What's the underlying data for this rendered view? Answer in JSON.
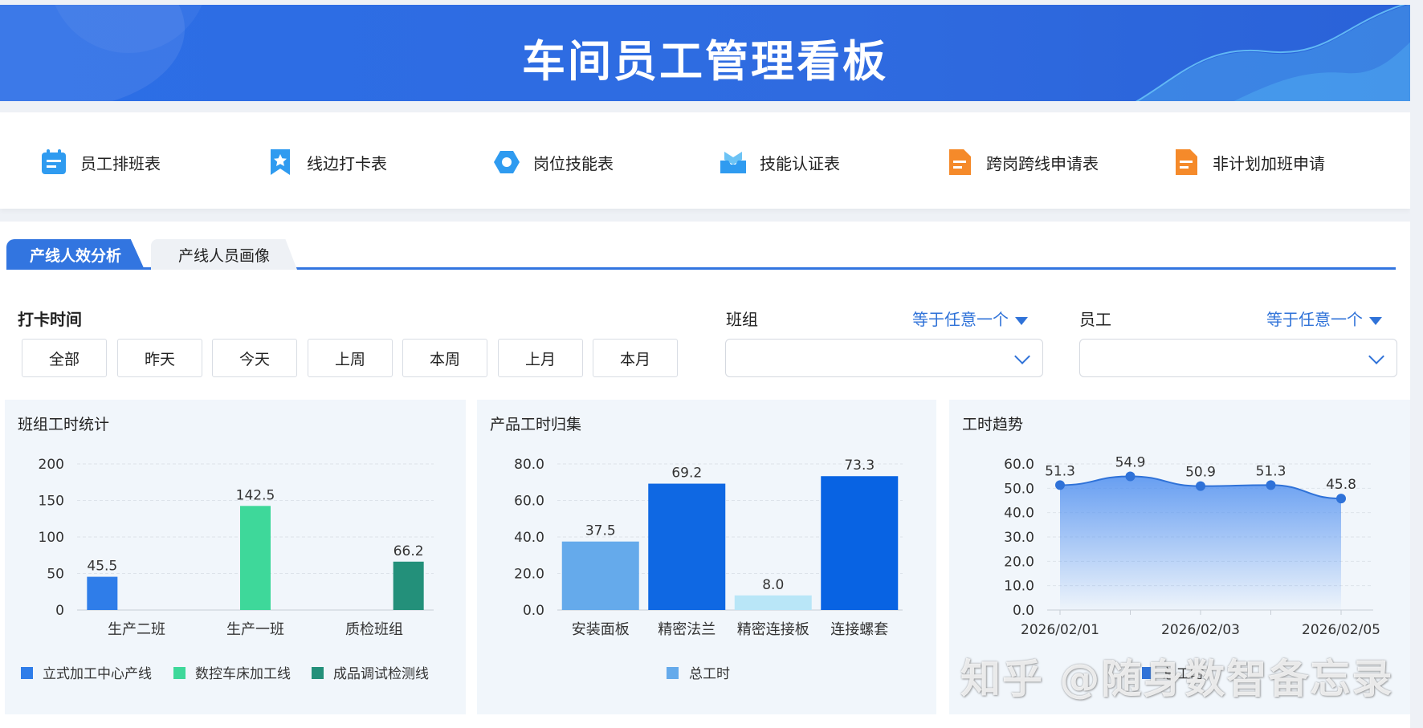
{
  "header": {
    "title": "车间员工管理看板"
  },
  "quicklinks": [
    {
      "label": "员工排班表",
      "icon": "calendar-icon",
      "color": "#2f9bf0"
    },
    {
      "label": "线边打卡表",
      "icon": "bookmark-star-icon",
      "color": "#2f9bf0"
    },
    {
      "label": "岗位技能表",
      "icon": "hexagon-icon",
      "color": "#2f9bf0"
    },
    {
      "label": "技能认证表",
      "icon": "inbox-tray-icon",
      "color": "#2f9bf0"
    },
    {
      "label": "跨岗跨线申请表",
      "icon": "document-icon",
      "color": "#f58a2a"
    },
    {
      "label": "非计划加班申请",
      "icon": "document-icon",
      "color": "#f58a2a"
    }
  ],
  "tabs": [
    {
      "label": "产线人效分析",
      "active": true
    },
    {
      "label": "产线人员画像",
      "active": false
    }
  ],
  "filters": {
    "clock_time_label": "打卡时间",
    "time_buttons": [
      "全部",
      "昨天",
      "今天",
      "上周",
      "本周",
      "上月",
      "本月"
    ],
    "team_label": "班组",
    "team_op": "等于任意一个",
    "team_value": "",
    "employee_label": "员工",
    "employee_op": "等于任意一个",
    "employee_value": ""
  },
  "cards": {
    "team_hours_title": "班组工时统计",
    "product_hours_title": "产品工时归集",
    "trend_title": "工时趋势"
  },
  "watermark": "知乎 @随身数智备忘录",
  "chart_data": [
    {
      "type": "bar",
      "title": "班组工时统计",
      "categories": [
        "生产二班",
        "生产一班",
        "质检班组"
      ],
      "series": [
        {
          "name": "立式加工中心产线",
          "values": [
            45.5,
            null,
            null
          ],
          "color": "#2f7de9"
        },
        {
          "name": "数控车床加工线",
          "values": [
            null,
            142.5,
            null
          ],
          "color": "#3ed89a"
        },
        {
          "name": "成品调试检测线",
          "values": [
            null,
            null,
            66.2
          ],
          "color": "#23907a"
        }
      ],
      "yticks": [
        "0",
        "50",
        "100",
        "150",
        "200"
      ],
      "ylim": [
        0,
        200
      ],
      "grid": true,
      "legend": "bottom"
    },
    {
      "type": "bar",
      "title": "产品工时归集",
      "categories": [
        "安装面板",
        "精密法兰",
        "精密连接板",
        "连接螺套"
      ],
      "series": [
        {
          "name": "总工时",
          "values": [
            37.5,
            69.2,
            8.0,
            73.3
          ]
        }
      ],
      "bar_colors": [
        "#65aaeb",
        "#0f68e3",
        "#b9e6f7",
        "#0863e3"
      ],
      "data_labels": [
        "37.5",
        "69.2",
        "8.0",
        "73.3"
      ],
      "yticks": [
        "0.0",
        "20.0",
        "40.0",
        "60.0",
        "80.0"
      ],
      "ylim": [
        0,
        80
      ],
      "grid": true,
      "legend": "bottom"
    },
    {
      "type": "area",
      "title": "工时趋势",
      "x": [
        "2026/02/01",
        "2026/02/02",
        "2026/02/03",
        "2026/02/04",
        "2026/02/05"
      ],
      "xtick_labels": [
        "2026/02/01",
        "2026/02/03",
        "2026/02/05"
      ],
      "series": [
        {
          "name": "总工时",
          "values": [
            51.3,
            54.9,
            50.9,
            51.3,
            45.8
          ],
          "color": "#2f72d8"
        }
      ],
      "data_labels": [
        "51.3",
        "54.9",
        "50.9",
        "51.3",
        "45.8"
      ],
      "yticks": [
        "0.0",
        "10.0",
        "20.0",
        "30.0",
        "40.0",
        "50.0",
        "60.0"
      ],
      "ylim": [
        0,
        60
      ],
      "grid": true,
      "legend": "bottom"
    }
  ]
}
